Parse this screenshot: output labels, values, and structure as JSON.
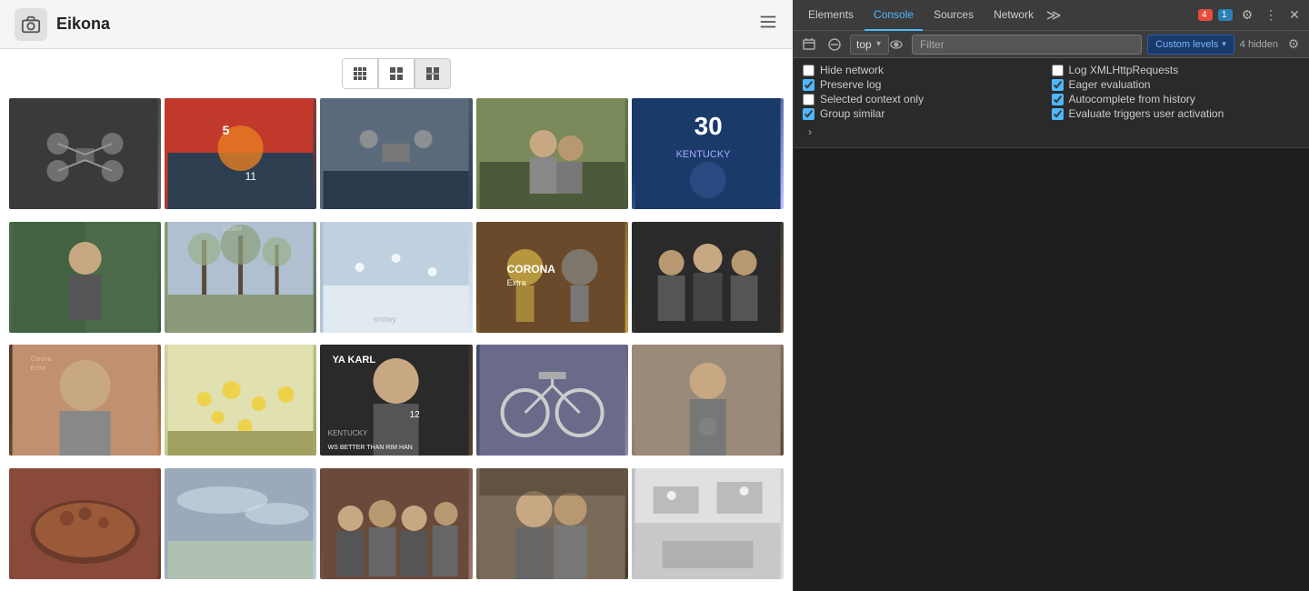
{
  "app": {
    "title": "Eikona",
    "logo_icon": "📷"
  },
  "view_controls": {
    "buttons": [
      {
        "icon": "⊞",
        "label": "small-grid",
        "active": false
      },
      {
        "icon": "⊟",
        "label": "medium-grid",
        "active": false
      },
      {
        "icon": "▦",
        "label": "large-grid",
        "active": true
      }
    ]
  },
  "images": [
    {
      "id": 1,
      "cls": "img-drone1",
      "alt": "drone photo 1"
    },
    {
      "id": 2,
      "cls": "img-bball",
      "alt": "basketball player"
    },
    {
      "id": 3,
      "cls": "img-drone2",
      "alt": "drone photo 2"
    },
    {
      "id": 4,
      "cls": "img-people1",
      "alt": "people outdoors"
    },
    {
      "id": 5,
      "cls": "img-bball2",
      "alt": "basketball player Kentucky"
    },
    {
      "id": 6,
      "cls": "img-man1",
      "alt": "man outdoors"
    },
    {
      "id": 7,
      "cls": "img-trees",
      "alt": "trees in winter"
    },
    {
      "id": 8,
      "cls": "img-snow",
      "alt": "snowy landscape"
    },
    {
      "id": 9,
      "cls": "img-lucha",
      "alt": "lucha libre Corona"
    },
    {
      "id": 10,
      "cls": "img-group1",
      "alt": "group photo"
    },
    {
      "id": 11,
      "cls": "img-meme1",
      "alt": "meme photo"
    },
    {
      "id": 12,
      "cls": "img-flowers",
      "alt": "flowers"
    },
    {
      "id": 13,
      "cls": "img-yakarl",
      "alt": "Ya Karl meme"
    },
    {
      "id": 14,
      "cls": "img-bike",
      "alt": "bike on car rack"
    },
    {
      "id": 15,
      "cls": "img-person2",
      "alt": "person with item"
    },
    {
      "id": 16,
      "cls": "img-food",
      "alt": "food photo"
    },
    {
      "id": 17,
      "cls": "img-sky",
      "alt": "grey sky"
    },
    {
      "id": 18,
      "cls": "img-dinner",
      "alt": "dinner group"
    },
    {
      "id": 19,
      "cls": "img-couple",
      "alt": "couple photo"
    },
    {
      "id": 20,
      "cls": "img-room",
      "alt": "room photo"
    }
  ],
  "devtools": {
    "tabs": [
      {
        "label": "Elements",
        "active": false
      },
      {
        "label": "Console",
        "active": true
      },
      {
        "label": "Sources",
        "active": false
      },
      {
        "label": "Network",
        "active": false
      }
    ],
    "more_tabs_icon": "≫",
    "badge_red_count": "4",
    "badge_blue_count": "1",
    "settings_icon": "⚙",
    "more_icon": "⋮",
    "close_icon": "✕",
    "toolbar2": {
      "dock_icon": "⊡",
      "no_entry_icon": "🚫",
      "context_value": "top",
      "eye_icon": "👁",
      "filter_placeholder": "Filter",
      "custom_levels_label": "Custom levels",
      "hidden_count_label": "4 hidden",
      "gear_icon": "⚙"
    },
    "settings": {
      "rows": [
        {
          "left": {
            "label": "Hide network",
            "checked": false,
            "id": "hide-network"
          },
          "right": {
            "label": "Log XMLHttpRequests",
            "checked": false,
            "id": "log-xml"
          }
        },
        {
          "left": {
            "label": "Preserve log",
            "checked": true,
            "id": "preserve-log"
          },
          "right": {
            "label": "Eager evaluation",
            "checked": true,
            "id": "eager-eval"
          }
        },
        {
          "left": {
            "label": "Selected context only",
            "checked": false,
            "id": "selected-ctx"
          },
          "right": {
            "label": "Autocomplete from history",
            "checked": true,
            "id": "autocomplete"
          }
        },
        {
          "left": {
            "label": "Group similar",
            "checked": true,
            "id": "group-similar"
          },
          "right": {
            "label": "Evaluate triggers user activation",
            "checked": true,
            "id": "eval-triggers"
          }
        }
      ],
      "more_label": "›"
    }
  }
}
